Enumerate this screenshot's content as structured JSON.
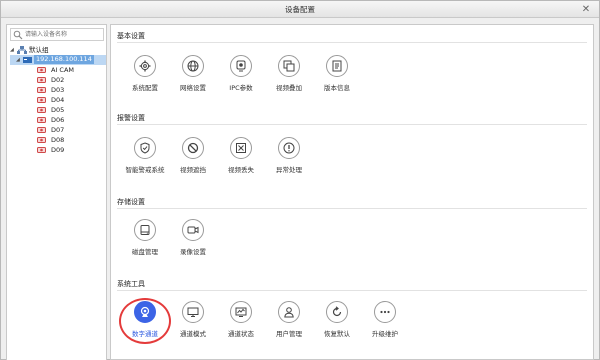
{
  "window": {
    "title": "设备配置",
    "close_glyph": "✕"
  },
  "left": {
    "search": {
      "placeholder": "请输入设备名称",
      "value": ""
    },
    "tree": {
      "group": "默认组",
      "device_ip": "192.168.100.114",
      "channels": [
        "AI CAM",
        "D02",
        "D03",
        "D04",
        "D05",
        "D06",
        "D07",
        "D08",
        "D09"
      ]
    }
  },
  "sections": [
    {
      "title": "基本设置",
      "items": [
        {
          "label": "系统配置",
          "icon": "gear-icon"
        },
        {
          "label": "网络设置",
          "icon": "globe-icon"
        },
        {
          "label": "IPC参数",
          "icon": "camera-icon"
        },
        {
          "label": "视频叠加",
          "icon": "overlay-icon"
        },
        {
          "label": "版本信息",
          "icon": "document-icon"
        }
      ]
    },
    {
      "title": "报警设置",
      "items": [
        {
          "label": "智能警戒系统",
          "icon": "shield-icon"
        },
        {
          "label": "视频遮挡",
          "icon": "block-icon"
        },
        {
          "label": "视频丢失",
          "icon": "box-x-icon"
        },
        {
          "label": "异常处理",
          "icon": "exclamation-icon"
        }
      ]
    },
    {
      "title": "存储设置",
      "items": [
        {
          "label": "磁盘管理",
          "icon": "disk-icon"
        },
        {
          "label": "录像设置",
          "icon": "record-icon"
        }
      ]
    },
    {
      "title": "系统工具",
      "items": [
        {
          "label": "数字通道",
          "icon": "webcam-icon",
          "active": true
        },
        {
          "label": "通道模式",
          "icon": "monitor-icon"
        },
        {
          "label": "通道状态",
          "icon": "status-icon"
        },
        {
          "label": "用户管理",
          "icon": "user-icon"
        },
        {
          "label": "恢复默认",
          "icon": "restore-icon"
        },
        {
          "label": "升级维护",
          "icon": "more-icon"
        }
      ]
    }
  ],
  "colors": {
    "accent": "#3c64e6",
    "highlight": "#e43b3b",
    "selection": "#6ea6e0"
  }
}
